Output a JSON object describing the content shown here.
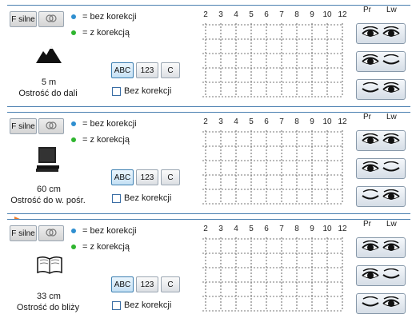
{
  "panels": [
    {
      "id": "far",
      "filter_label": "F silne",
      "legend_blue": "= bez korekcji",
      "legend_green": "= z korekcją",
      "mode_buttons": [
        "ABC",
        "123",
        "C"
      ],
      "checkbox_label": "Bez korekcji",
      "distance": "5 m",
      "description": "Ostrość do dali",
      "icon": "mountain-icon"
    },
    {
      "id": "mid",
      "filter_label": "F silne",
      "legend_blue": "= bez korekcji",
      "legend_green": "= z korekcją",
      "mode_buttons": [
        "ABC",
        "123",
        "C"
      ],
      "checkbox_label": "Bez korekcji",
      "distance": "60 cm",
      "description": "Ostrość do w. pośr.",
      "icon": "computer-icon"
    },
    {
      "id": "near",
      "filter_label": "F silne",
      "legend_blue": "= bez korekcji",
      "legend_green": "= z korekcją",
      "mode_buttons": [
        "ABC",
        "123",
        "C"
      ],
      "checkbox_label": "Bez korekcji",
      "distance": "33 cm",
      "description": "Ostrość do bliży",
      "icon": "book-icon"
    }
  ],
  "grid_columns": [
    "2",
    "3",
    "4",
    "5",
    "6",
    "7",
    "8",
    "9",
    "10",
    "12"
  ],
  "eye_headers": {
    "right": "Pr",
    "left": "Lw"
  },
  "eye_buttons": [
    "both-eyes-open-icon",
    "right-eye-open-left-closed-icon",
    "right-eye-closed-left-open-icon"
  ],
  "colors": {
    "accent": "#f07820",
    "legend_blue": "#2f8fd0",
    "legend_green": "#2fb52f",
    "frame": "#4a7fb0"
  }
}
